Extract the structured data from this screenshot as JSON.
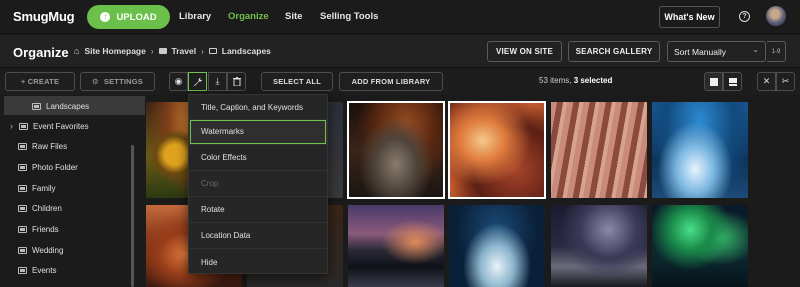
{
  "header": {
    "logo": "SmugMug",
    "upload_label": "UPLOAD",
    "nav": [
      {
        "label": "Library",
        "active": false
      },
      {
        "label": "Organize",
        "active": true
      },
      {
        "label": "Site",
        "active": false
      },
      {
        "label": "Selling Tools",
        "active": false
      }
    ],
    "whats_new": "What's New",
    "help_icon": "?",
    "accent_color": "#6bc04b"
  },
  "subheader": {
    "title": "Organize",
    "breadcrumb": [
      "Site Homepage",
      "Travel",
      "Landscapes"
    ],
    "view_on_site": "VIEW ON SITE",
    "search_gallery": "SEARCH GALLERY",
    "sort_value": "Sort Manually",
    "range": "1-9"
  },
  "toolbar": {
    "create": "+ CREATE",
    "settings": "SETTINGS",
    "select_all": "SELECT ALL",
    "add_from_library": "ADD FROM LIBRARY",
    "count_prefix": "53 items, ",
    "count_selected": "3 selected",
    "icons": [
      "eye-icon",
      "wrench-icon",
      "download-icon",
      "trash-icon",
      "grid-view-icon",
      "list-view-icon",
      "expand-icon",
      "collapse-icon"
    ]
  },
  "sidebar": {
    "items": [
      {
        "label": "Landscapes",
        "selected": true
      },
      {
        "label": "Event Favorites",
        "selected": false
      },
      {
        "label": "Raw Files",
        "selected": false
      },
      {
        "label": "Photo Folder",
        "selected": false
      },
      {
        "label": "Family",
        "selected": false
      },
      {
        "label": "Children",
        "selected": false
      },
      {
        "label": "Friends",
        "selected": false
      },
      {
        "label": "Wedding",
        "selected": false
      },
      {
        "label": "Events",
        "selected": false
      }
    ]
  },
  "menu": {
    "items": [
      {
        "label": "Title, Caption, and Keywords",
        "disabled": false
      },
      {
        "label": "Watermarks",
        "highlighted": true
      },
      {
        "label": "Color Effects",
        "disabled": false
      },
      {
        "label": "Crop",
        "disabled": true
      },
      {
        "label": "Rotate",
        "disabled": false
      },
      {
        "label": "Location Data",
        "disabled": false
      },
      {
        "label": "Hide",
        "disabled": false
      }
    ]
  },
  "photos": [
    {
      "name": "sunflower-field",
      "selected": false
    },
    {
      "name": "photo-2",
      "selected": false
    },
    {
      "name": "slot-canyon-stream",
      "selected": true
    },
    {
      "name": "antelope-canyon",
      "selected": true
    },
    {
      "name": "sandstone-waves",
      "selected": false
    },
    {
      "name": "ice-cave-river",
      "selected": false
    },
    {
      "name": "red-hoodoos",
      "selected": false
    },
    {
      "name": "photo-8",
      "selected": false
    },
    {
      "name": "mountain-lake-dusk",
      "selected": false
    },
    {
      "name": "ice-cave-tent",
      "selected": false
    },
    {
      "name": "milky-way-mountains",
      "selected": false
    },
    {
      "name": "aurora-lake",
      "selected": false
    }
  ]
}
